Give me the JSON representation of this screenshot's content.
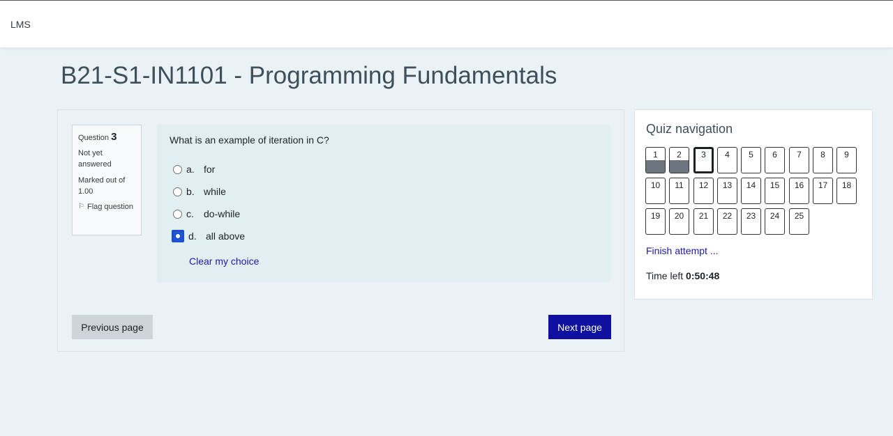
{
  "header": {
    "brand": "LMS"
  },
  "page": {
    "course_title": "B21-S1-IN1101 - Programming Fundamentals"
  },
  "question": {
    "label": "Question",
    "number": "3",
    "state": "Not yet answered",
    "marked": "Marked out of 1.00",
    "flag_label": "Flag question",
    "text": "What is an example of iteration in C?",
    "answers": [
      {
        "letter": "a.",
        "text": "for",
        "selected": false
      },
      {
        "letter": "b.",
        "text": "while",
        "selected": false
      },
      {
        "letter": "c.",
        "text": "do-while",
        "selected": false
      },
      {
        "letter": "d.",
        "text": "all above",
        "selected": true
      }
    ],
    "clear_label": "Clear my choice"
  },
  "buttons": {
    "previous": "Previous page",
    "next": "Next page"
  },
  "quiz_nav": {
    "title": "Quiz navigation",
    "questions": [
      {
        "num": "1",
        "state": "answered"
      },
      {
        "num": "2",
        "state": "answered"
      },
      {
        "num": "3",
        "state": "current"
      },
      {
        "num": "4",
        "state": "unanswered"
      },
      {
        "num": "5",
        "state": "unanswered"
      },
      {
        "num": "6",
        "state": "unanswered"
      },
      {
        "num": "7",
        "state": "unanswered"
      },
      {
        "num": "8",
        "state": "unanswered"
      },
      {
        "num": "9",
        "state": "unanswered"
      },
      {
        "num": "10",
        "state": "unanswered"
      },
      {
        "num": "11",
        "state": "unanswered"
      },
      {
        "num": "12",
        "state": "unanswered"
      },
      {
        "num": "13",
        "state": "unanswered"
      },
      {
        "num": "14",
        "state": "unanswered"
      },
      {
        "num": "15",
        "state": "unanswered"
      },
      {
        "num": "16",
        "state": "unanswered"
      },
      {
        "num": "17",
        "state": "unanswered"
      },
      {
        "num": "18",
        "state": "unanswered"
      },
      {
        "num": "19",
        "state": "unanswered"
      },
      {
        "num": "20",
        "state": "unanswered"
      },
      {
        "num": "21",
        "state": "unanswered"
      },
      {
        "num": "22",
        "state": "unanswered"
      },
      {
        "num": "23",
        "state": "unanswered"
      },
      {
        "num": "24",
        "state": "unanswered"
      },
      {
        "num": "25",
        "state": "unanswered"
      }
    ],
    "finish_label": "Finish attempt ...",
    "time_label": "Time left",
    "time_value": "0:50:48"
  },
  "colors": {
    "accent": "#0f0fa0",
    "link": "#1a1aa6",
    "background": "#eaf2f5",
    "answered": "#6c757d"
  }
}
